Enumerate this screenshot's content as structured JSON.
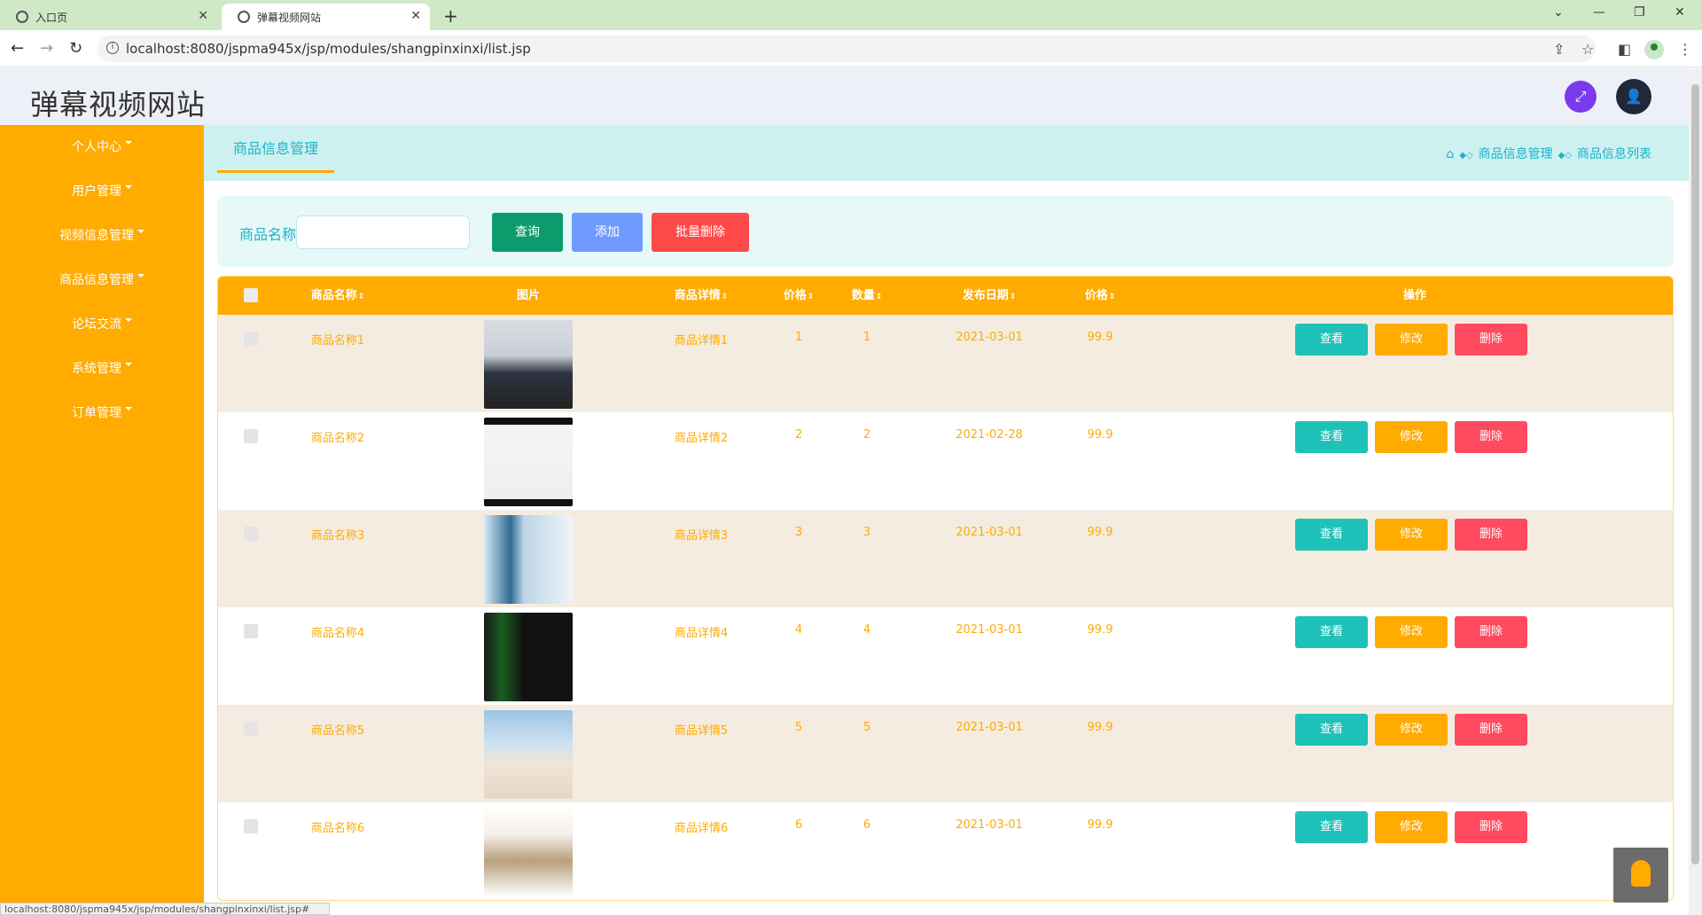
{
  "browser": {
    "tabs": [
      {
        "title": "入口页",
        "active": false
      },
      {
        "title": "弹幕视频网站",
        "active": true
      }
    ],
    "url": "localhost:8080/jspma945x/jsp/modules/shangpinxinxi/list.jsp",
    "status_url": "localhost:8080/jspma945x/jsp/modules/shangpinxinxi/list.jsp#"
  },
  "app": {
    "title": "弹幕视频网站",
    "accent_color": "#ffab00",
    "teal_color": "#19b3c9"
  },
  "sidebar": {
    "items": [
      {
        "label": "个人中心"
      },
      {
        "label": "用户管理"
      },
      {
        "label": "视频信息管理"
      },
      {
        "label": "商品信息管理"
      },
      {
        "label": "论坛交流"
      },
      {
        "label": "系统管理"
      },
      {
        "label": "订单管理"
      }
    ]
  },
  "breadcrumb": {
    "tab": "商品信息管理",
    "items": [
      "商品信息管理",
      "商品信息列表"
    ]
  },
  "search": {
    "label": "商品名称",
    "value": "",
    "query_btn": "查询",
    "add_btn": "添加",
    "batch_delete_btn": "批量删除"
  },
  "table": {
    "columns": [
      "商品名称",
      "图片",
      "商品详情",
      "价格",
      "数量",
      "发布日期",
      "价格",
      "操作"
    ],
    "rows": [
      {
        "name": "商品名称1",
        "detail": "商品详情1",
        "price": "1",
        "qty": "1",
        "date": "2021-03-01",
        "price2": "99.9",
        "image": "woman-denim-jacket"
      },
      {
        "name": "商品名称2",
        "detail": "商品详情2",
        "price": "2",
        "qty": "2",
        "date": "2021-02-28",
        "price2": "99.9",
        "image": "book-cover"
      },
      {
        "name": "商品名称3",
        "detail": "商品详情3",
        "price": "3",
        "qty": "3",
        "date": "2021-03-01",
        "price2": "99.9",
        "image": "serum-bottle"
      },
      {
        "name": "商品名称4",
        "detail": "商品详情4",
        "price": "4",
        "qty": "4",
        "date": "2021-03-01",
        "price2": "99.9",
        "image": "energy-drink"
      },
      {
        "name": "商品名称5",
        "detail": "商品详情5",
        "price": "5",
        "qty": "5",
        "date": "2021-03-01",
        "price2": "99.9",
        "image": "woman-white-dress"
      },
      {
        "name": "商品名称6",
        "detail": "商品详情6",
        "price": "6",
        "qty": "6",
        "date": "2021-03-01",
        "price2": "99.9",
        "image": "boots"
      }
    ],
    "actions": {
      "view": "查看",
      "edit": "修改",
      "delete": "删除"
    }
  }
}
